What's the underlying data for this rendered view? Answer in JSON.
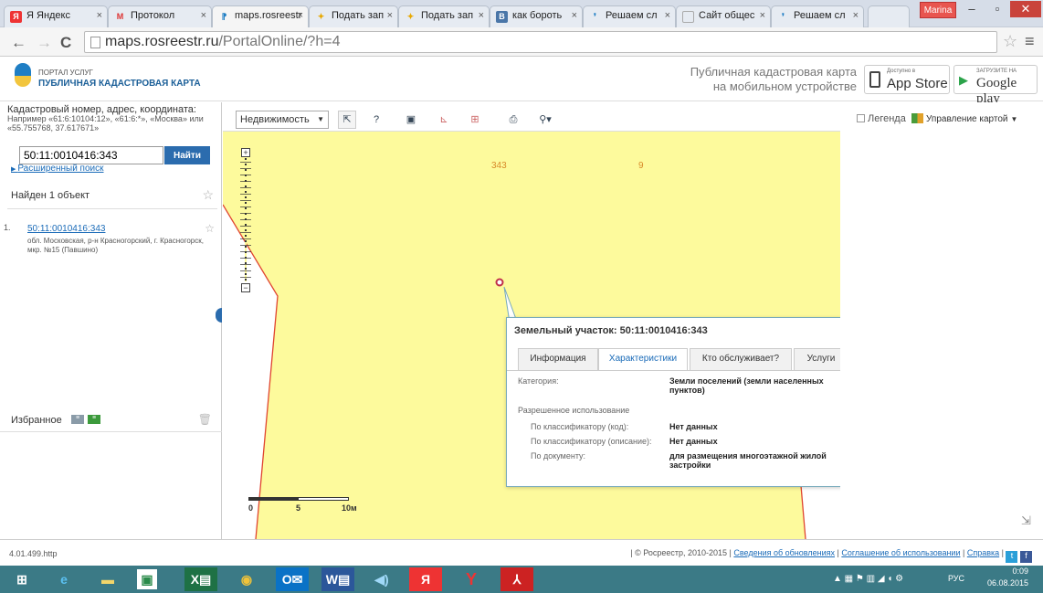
{
  "browser": {
    "tabs": [
      {
        "label": "Я Яндекс",
        "icon": "yandex-icon"
      },
      {
        "label": "Протокол",
        "icon": "gmail-icon"
      },
      {
        "label": "maps.rosreestr",
        "icon": "page-icon"
      },
      {
        "label": "Подать зап",
        "icon": "portal-icon"
      },
      {
        "label": "Подать зап",
        "icon": "portal-icon"
      },
      {
        "label": "как бороть",
        "icon": "vk-icon"
      },
      {
        "label": "Решаем сл",
        "icon": "portal-icon"
      },
      {
        "label": "Сайт общес",
        "icon": "page-icon"
      },
      {
        "label": "Решаем сл",
        "icon": "portal-icon"
      }
    ],
    "user": "Marina",
    "url_host": "maps.rosreestr.ru",
    "url_path": "/PortalOnline/?h=4"
  },
  "header": {
    "logo_line1": "ПОРТАЛ УСЛУГ",
    "logo_line2": "ПУБЛИЧНАЯ КАДАСТРОВАЯ КАРТА",
    "mobile_line1": "Публичная кадастровая карта",
    "mobile_line2": "на мобильном устройстве",
    "appstore_small": "Доступно в",
    "appstore_big": "App Store",
    "gplay_small": "ЗАГРУЗИТЕ НА",
    "gplay_big": "Google play"
  },
  "sidebar": {
    "hint_title": "Кадастровый номер, адрес, координата:",
    "hint_example": "Например «61:6:10104:12», «61:6:*», «Москва» или «55.755768, 37.617671»",
    "search_value": "50:11:0010416:343",
    "find_label": "Найти",
    "advanced_label": "Расширенный поиск",
    "found_label": "Найден 1 объект",
    "results": [
      {
        "num": "1.",
        "number": "50:11:0010416:343",
        "address": "обл. Московская, р-н Красногорский, г. Красногорск, мкр. №15 (Павшино)"
      }
    ],
    "favorites_label": "Избранное"
  },
  "toolbar": {
    "layer_select": "Недвижимость",
    "legend_label": "Легенда",
    "manage_label": "Управление картой"
  },
  "map": {
    "parcel_labels": [
      "343",
      "9"
    ],
    "scale_labels": [
      "0",
      "5",
      "10м"
    ]
  },
  "popup": {
    "title": "Земельный участок: 50:11:0010416:343",
    "tabs": [
      "Информация",
      "Характеристики",
      "Кто обслуживает?",
      "Услуги"
    ],
    "category_label": "Категория:",
    "category_value": "Земли поселений (земли населенных пунктов)",
    "permitted_label": "Разрешенное использование",
    "rows": [
      {
        "label": "По классификатору (код):",
        "value": "Нет данных"
      },
      {
        "label": "По классификатору (описание):",
        "value": "Нет данных"
      },
      {
        "label": "По документу:",
        "value": "для размещения многоэтажной жилой застройки"
      }
    ]
  },
  "status": {
    "version": "4.01.499.http",
    "copyright": "| © Росреестр, 2010-2015 |",
    "links": [
      "Сведения об обновлениях",
      "Соглашение об использовании",
      "Справка"
    ]
  },
  "taskbar": {
    "lang": "РУС",
    "time": "0:09",
    "date": "06.08.2015"
  },
  "colors": {
    "map_fill": "#fdfa9c",
    "boundary": "#e0442f",
    "link": "#1a6bb8",
    "taskbar": "#3b7a86"
  }
}
